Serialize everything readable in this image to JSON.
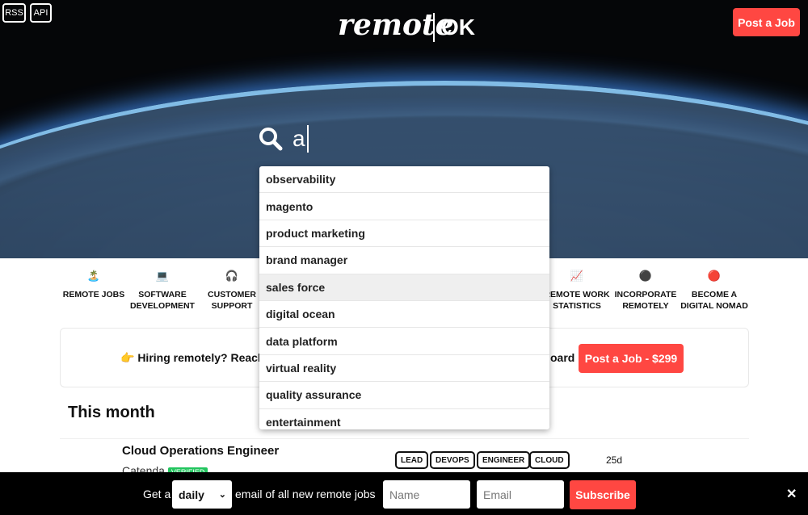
{
  "header": {
    "rss": "RSS",
    "api": "API",
    "logo_main": "remote",
    "logo_ok": "OK",
    "post_job": "Post a Job"
  },
  "search": {
    "query": "a",
    "icon": "search-icon",
    "suggestions": [
      "observability",
      "magento",
      "product marketing",
      "brand manager",
      "sales force",
      "digital ocean",
      "data platform",
      "virtual reality",
      "quality assurance",
      "entertainment"
    ],
    "highlighted": "sales force"
  },
  "categories": [
    {
      "icon": "🏝️",
      "label1": "REMOTE JOBS",
      "label2": ""
    },
    {
      "icon": "💻",
      "label1": "SOFTWARE",
      "label2": "DEVELOPMENT"
    },
    {
      "icon": "🎧",
      "label1": "CUSTOMER",
      "label2": "SUPPORT"
    },
    {
      "icon": "📈",
      "label1": "REMOTE WORK",
      "label2": "STATISTICS"
    },
    {
      "icon": "⚫",
      "label1": "INCORPORATE",
      "label2": "REMOTELY"
    },
    {
      "icon": "🔴",
      "label1": "BECOME A",
      "label2": "DIGITAL NOMAD"
    }
  ],
  "banner": {
    "text_left": "👉  Hiring remotely? Reach",
    "text_right": "oard",
    "button": "Post a Job - $299"
  },
  "section_title": "This month",
  "job": {
    "title": "Cloud Operations Engineer",
    "company": "Catenda",
    "badge": "VERIFIED",
    "tags": [
      "LEAD",
      "DEVOPS",
      "ENGINEER",
      "CLOUD"
    ],
    "age": "25d"
  },
  "footer": {
    "get_a": "Get a",
    "frequency": "daily",
    "text": "email of all new remote jobs",
    "name_placeholder": "Name",
    "email_placeholder": "Email",
    "subscribe": "Subscribe",
    "close": "✕"
  },
  "colors": {
    "accent": "#ff4742"
  }
}
